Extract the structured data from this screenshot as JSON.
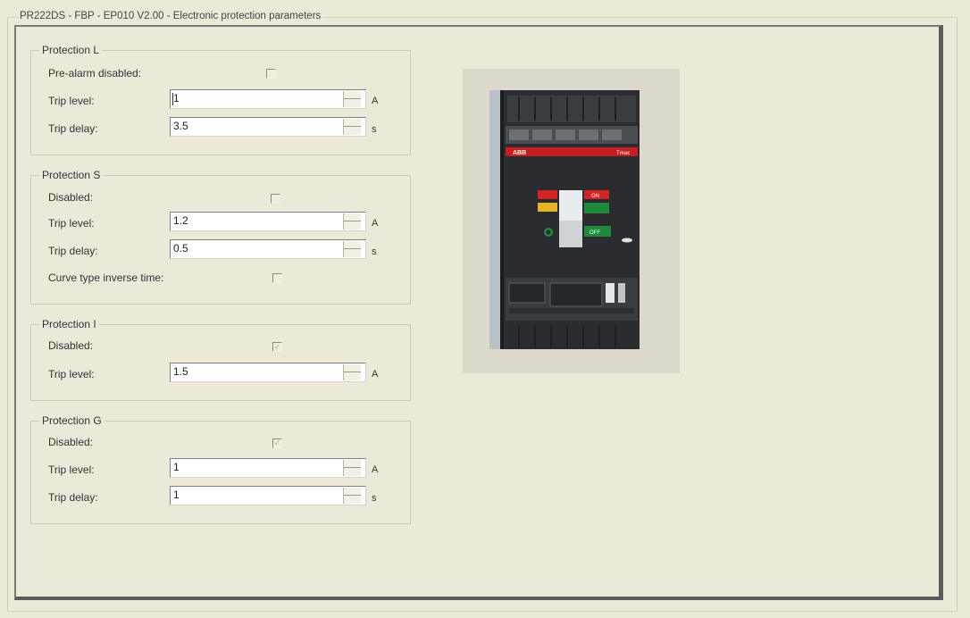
{
  "window_title": "PR222DS - FBP - EP010 V2.00 - Electronic protection parameters",
  "protection_l": {
    "title": "Protection L",
    "pre_alarm_label": "Pre-alarm disabled:",
    "pre_alarm_checked": false,
    "trip_level_label": "Trip level:",
    "trip_level_value": "1",
    "trip_level_unit": "A",
    "trip_delay_label": "Trip delay:",
    "trip_delay_value": "3.5",
    "trip_delay_unit": "s"
  },
  "protection_s": {
    "title": "Protection S",
    "disabled_label": "Disabled:",
    "disabled_checked": false,
    "trip_level_label": "Trip level:",
    "trip_level_value": "1.2",
    "trip_level_unit": "A",
    "trip_delay_label": "Trip delay:",
    "trip_delay_value": "0.5",
    "trip_delay_unit": "s",
    "curve_label": "Curve type inverse time:",
    "curve_checked": false
  },
  "protection_i": {
    "title": "Protection I",
    "disabled_label": "Disabled:",
    "disabled_checked": true,
    "trip_level_label": "Trip level:",
    "trip_level_value": "1.5",
    "trip_level_unit": "A"
  },
  "protection_g": {
    "title": "Protection G",
    "disabled_label": "Disabled:",
    "disabled_checked": true,
    "trip_level_label": "Trip level:",
    "trip_level_value": "1",
    "trip_level_unit": "A",
    "trip_delay_label": "Trip delay:",
    "trip_delay_value": "1",
    "trip_delay_unit": "s"
  },
  "image": {
    "subject": "ABB Tmax circuit breaker photo",
    "brand_label": "ABB",
    "model_label": "Tmax",
    "on_label": "ON",
    "off_label": "OFF"
  },
  "colors": {
    "background": "#ece9d8",
    "panel_border": "#5b5b5b",
    "breaker_body": "#2a2c2f",
    "brand_red": "#c61e1e"
  }
}
